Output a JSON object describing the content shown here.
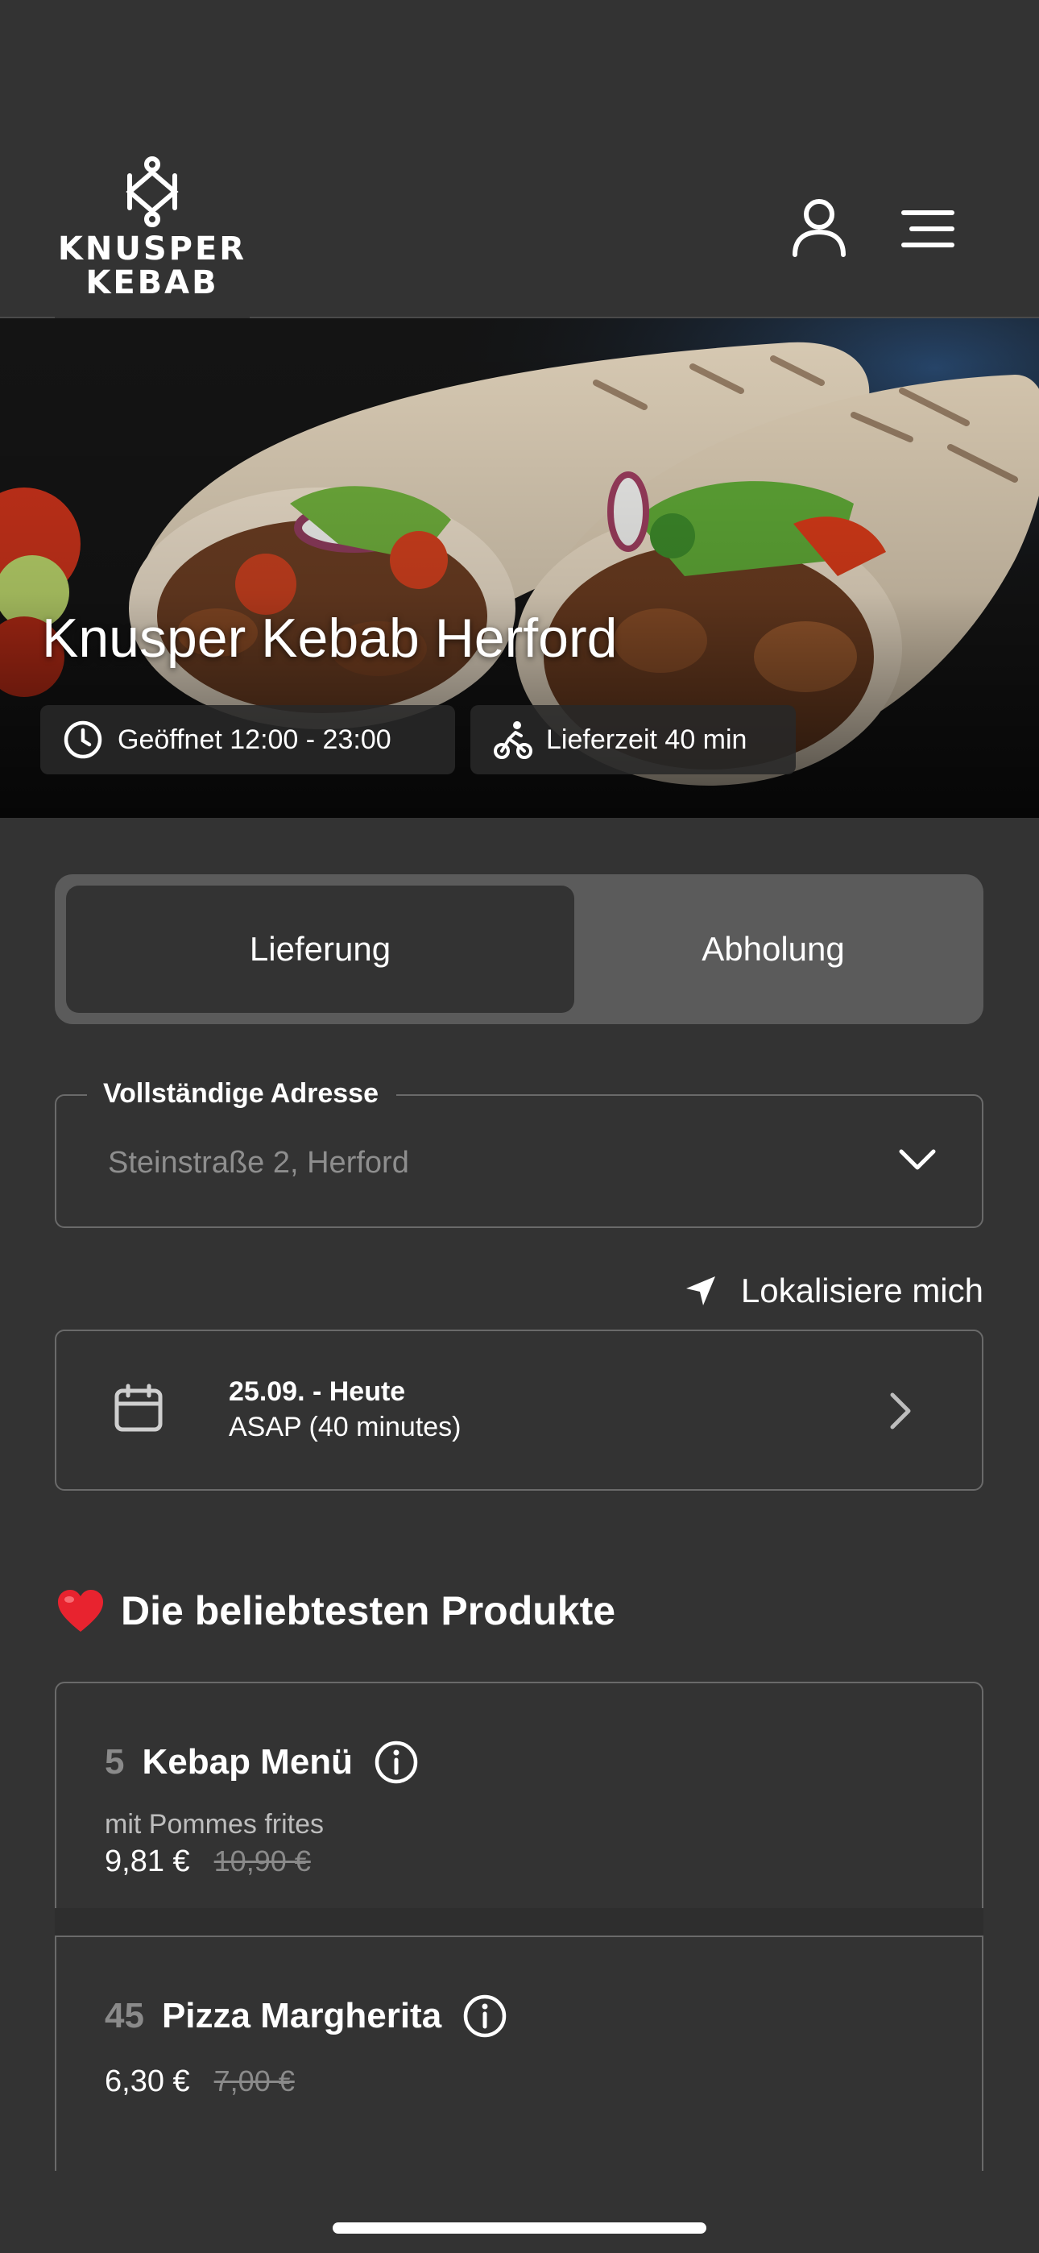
{
  "header": {
    "logo_line1": "KNUSPER",
    "logo_line2": "KEBAB",
    "user_icon": "user-icon",
    "menu_icon": "hamburger-menu-icon"
  },
  "hero": {
    "title": "Knusper Kebab Herford",
    "opening": "Geöffnet 12:00 - 23:00",
    "delivery_time": "Lieferzeit 40 min",
    "opening_icon": "clock-icon",
    "delivery_icon": "bicycle-rider-icon"
  },
  "order_mode": {
    "delivery": "Lieferung",
    "pickup": "Abholung",
    "selected": "Lieferung"
  },
  "address": {
    "label": "Vollständige Adresse",
    "value": "Steinstraße 2, Herford"
  },
  "locate": {
    "label": "Lokalisiere mich"
  },
  "schedule": {
    "date": "25.09. - Heute",
    "time": "ASAP (40 minutes)"
  },
  "popular": {
    "title": "Die beliebtesten Produkte",
    "products": [
      {
        "number": "5",
        "name": "Kebap Menü",
        "description": "mit Pommes frites",
        "price": "9,81 €",
        "old_price": "10,90 €"
      },
      {
        "number": "45",
        "name": "Pizza Margherita",
        "price": "6,30 €",
        "old_price": "7,00 €"
      }
    ]
  },
  "colors": {
    "background": "#333333",
    "segment_bg": "#5b5b5b",
    "border": "#6a6a6a",
    "heart": "#e8232f"
  }
}
